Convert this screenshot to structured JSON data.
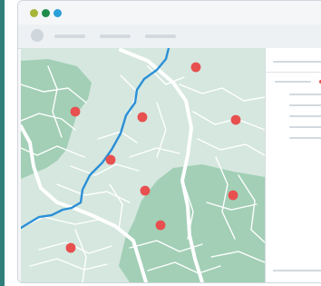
{
  "window": {
    "controls": [
      {
        "name": "window-dot-olive",
        "color": "#a8b53b"
      },
      {
        "name": "window-dot-green",
        "color": "#1e8d4c"
      },
      {
        "name": "window-dot-blue",
        "color": "#2aa0d8"
      }
    ]
  },
  "toolbar": {
    "placeholders": 3
  },
  "map": {
    "land_color": "#d5e7df",
    "park_color": "#a2cfb6",
    "river_color": "#2b8fd6",
    "road_color": "#ffffff",
    "marker_color": "#e8504f",
    "marker_count": 9
  },
  "side_panel": {
    "accent_color": "#e8504f"
  }
}
